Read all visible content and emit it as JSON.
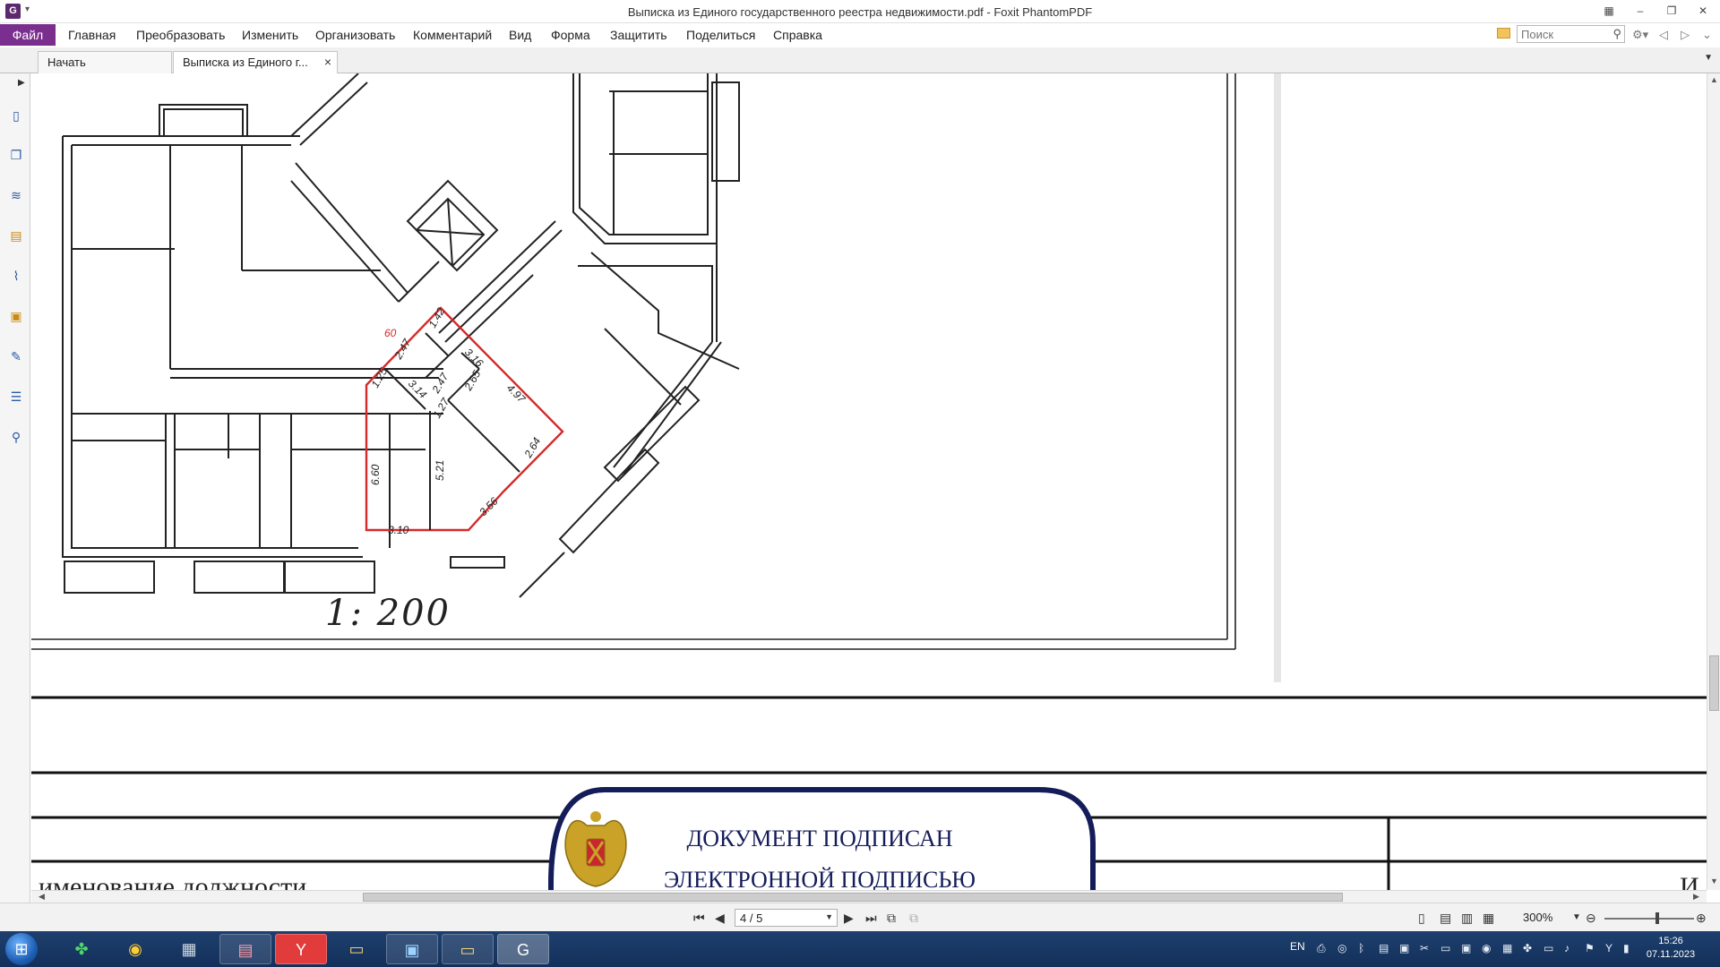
{
  "titlebar": {
    "title": "Выписка из Единого государственного реестра недвижимости.pdf - Foxit PhantomPDF",
    "app_icon_letter": "G"
  },
  "menu": {
    "file": "Файл",
    "items": [
      "Главная",
      "Преобразовать",
      "Изменить",
      "Организовать",
      "Комментарий",
      "Вид",
      "Форма",
      "Защитить",
      "Поделиться",
      "Справка"
    ],
    "search_placeholder": "Поиск"
  },
  "tabs": [
    {
      "label": "Начать"
    },
    {
      "label": "Выписка из Единого г..."
    }
  ],
  "document": {
    "scale": "1: 200",
    "room_label": "60",
    "dimensions": [
      "1.42",
      "2.47",
      "3.16",
      "1.25",
      "3.14",
      "2.47",
      "2.65",
      "4.97",
      "1.27",
      "2.64",
      "6.60",
      "5.21",
      "3.56",
      "3.10"
    ],
    "stamp_title": "ДОКУМЕНТ ПОДПИСАН",
    "stamp_subtitle": "ЭЛЕКТРОННОЙ ПОДПИСЬЮ",
    "position_label": "именование должности",
    "position_label_right": "И"
  },
  "status": {
    "page": "4 / 5",
    "zoom": "300%"
  },
  "taskbar": {
    "language": "EN",
    "time": "15:26",
    "date": "07.11.2023"
  },
  "colors": {
    "accent": "#7a2f8f",
    "highlight_outline": "#d42a2a",
    "stamp_border": "#141c5a"
  }
}
